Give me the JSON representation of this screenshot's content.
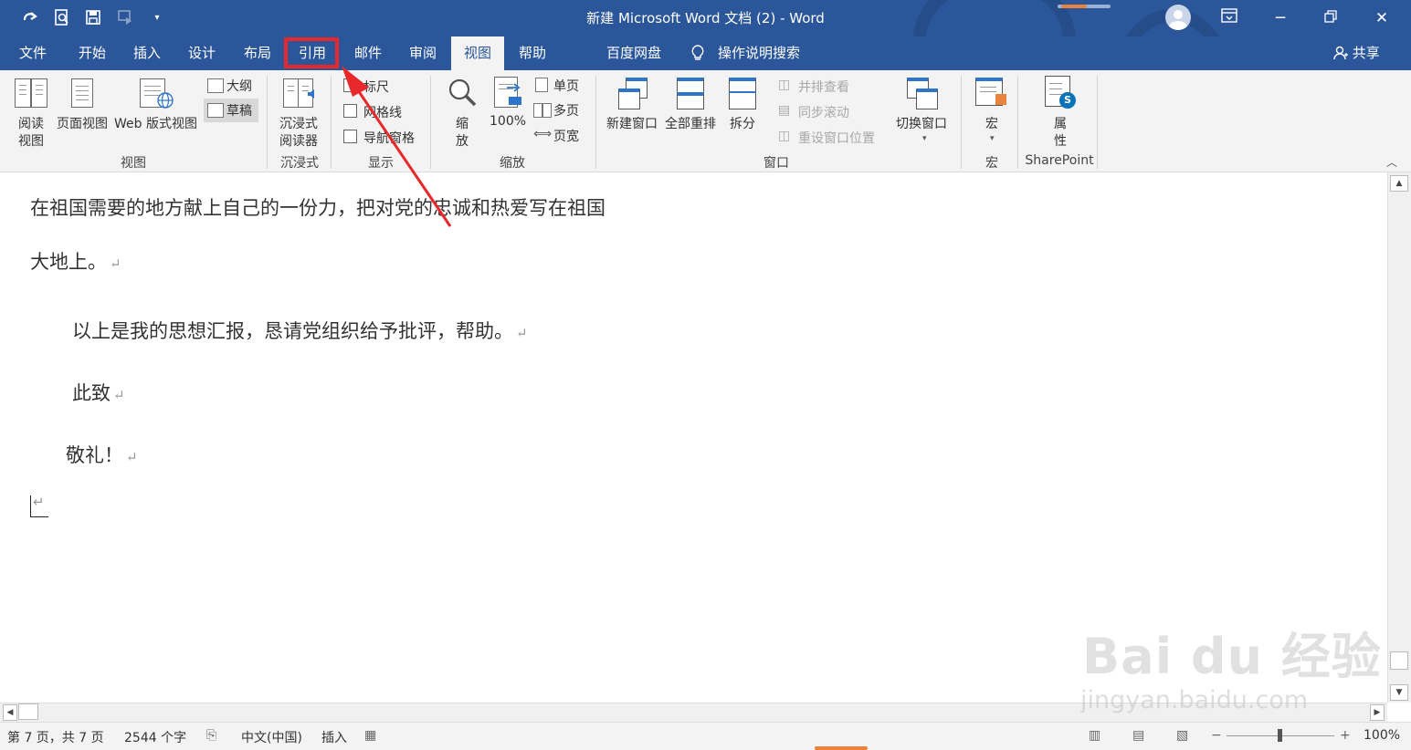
{
  "window": {
    "title": "新建 Microsoft Word 文档 (2)  -  Word"
  },
  "quick_access": {
    "icons": [
      "redo-icon",
      "print-preview-icon",
      "save-icon",
      "touch-mode-icon",
      "customize-qat-icon"
    ]
  },
  "tabs": [
    {
      "label": "文件"
    },
    {
      "label": "开始"
    },
    {
      "label": "插入"
    },
    {
      "label": "设计"
    },
    {
      "label": "布局"
    },
    {
      "label": "引用",
      "highlighted": true
    },
    {
      "label": "邮件"
    },
    {
      "label": "审阅"
    },
    {
      "label": "视图",
      "active": true
    },
    {
      "label": "帮助"
    },
    {
      "label": "百度网盘"
    },
    {
      "label": "操作说明搜索"
    }
  ],
  "share_label": "共享",
  "ribbon": {
    "views": {
      "read_mode": "阅读\n视图",
      "read_mode_1": "阅读",
      "read_mode_2": "视图",
      "print_layout": "页面视图",
      "web_layout": "Web 版式视图",
      "outline": "大纲",
      "draft": "草稿",
      "group": "视图"
    },
    "immersive": {
      "reader_1": "沉浸式",
      "reader_2": "阅读器",
      "group": "沉浸式"
    },
    "show": {
      "ruler": "标尺",
      "gridlines": "网格线",
      "nav_pane": "导航窗格",
      "group": "显示"
    },
    "zoom": {
      "zoom_1": "缩",
      "zoom_2": "放",
      "hundred": "100%",
      "one_page": "单页",
      "multi_page": "多页",
      "page_width": "页宽",
      "group": "缩放"
    },
    "window": {
      "new_window": "新建窗口",
      "arrange_all": "全部重排",
      "split": "拆分",
      "side_by_side": "并排查看",
      "sync_scroll": "同步滚动",
      "reset_position": "重设窗口位置",
      "switch_windows": "切换窗口",
      "group": "窗口"
    },
    "macros": {
      "macros": "宏",
      "group": "宏"
    },
    "sharepoint": {
      "props_1": "属",
      "props_2": "性",
      "group": "SharePoint"
    }
  },
  "document": {
    "line1": "在祖国需要的地方献上自己的一份力，把对党的忠诚和热爱写在祖国",
    "line2": "大地上。",
    "line3": "以上是我的思想汇报，恳请党组织给予批评，帮助。",
    "line4": "此致",
    "line5": "敬礼！",
    "para_mark": "↵"
  },
  "status_bar": {
    "page": "第 7 页，共 7 页",
    "words": "2544 个字",
    "language": "中文(中国)",
    "mode": "插入",
    "zoom": "100%",
    "zoom_level": 1.0
  },
  "watermark": {
    "logo": "Bai du 经验",
    "url": "jingyan.baidu.com"
  },
  "colors": {
    "brand": "#2b579a",
    "ribbon_bg": "#f3f3f3",
    "annotation": "#e8282a"
  }
}
